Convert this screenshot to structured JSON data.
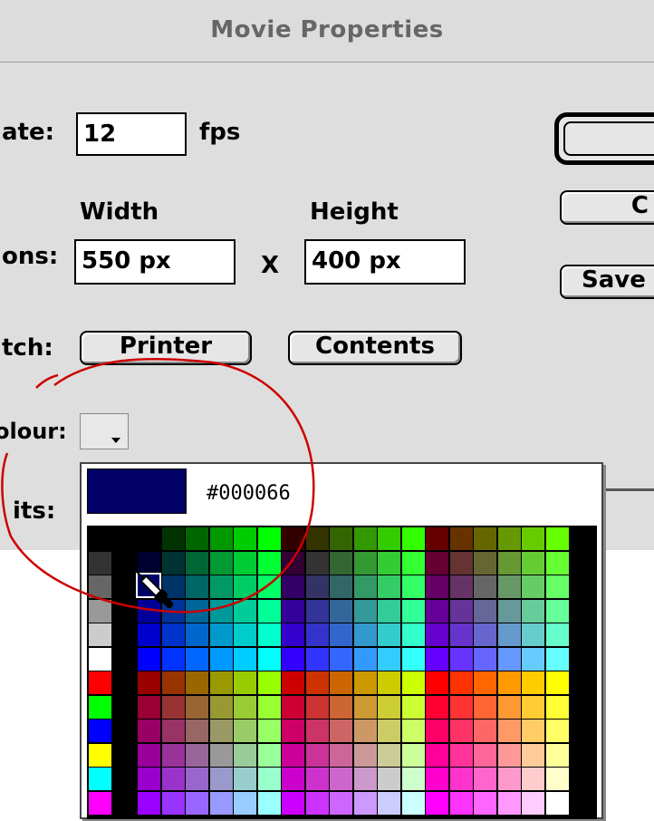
{
  "window": {
    "title": "Movie Properties"
  },
  "fields": {
    "frame_rate": {
      "label": "ate:",
      "value": "12",
      "unit": "fps"
    },
    "dimensions": {
      "label": "ons:",
      "width_header": "Width",
      "height_header": "Height",
      "width_value": "550 px",
      "height_value": "400 px",
      "separator": "X"
    },
    "match": {
      "label": "tch:",
      "printer_button": "Printer",
      "contents_button": "Contents"
    },
    "background": {
      "label": "olour:"
    },
    "ruler_units": {
      "label": "its:"
    }
  },
  "buttons": {
    "cancel": "C",
    "save_default": "Save"
  },
  "color_picker": {
    "selected_hex": "#000066",
    "selected_color": "#000066"
  },
  "annotation": {
    "shape": "red-freehand-circle",
    "color": "#cc0000"
  }
}
